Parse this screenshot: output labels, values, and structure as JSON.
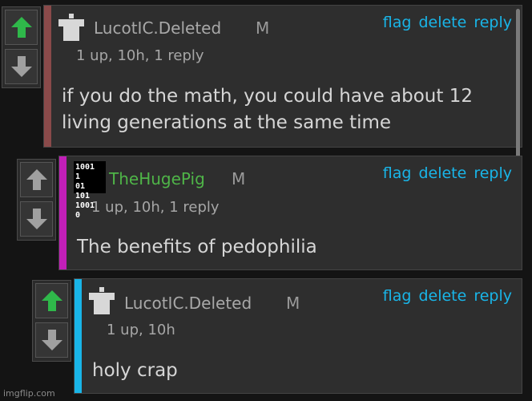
{
  "actions": {
    "flag": "flag",
    "delete": "delete",
    "reply": "reply"
  },
  "comments": [
    {
      "username": "LucotIC.Deleted",
      "badge": "M",
      "meta": "1 up, 10h, 1 reply",
      "body_lines": [
        "if you do the math, you could have about 12",
        "living generations at the same time"
      ],
      "accent": "#8a4a4a",
      "username_color": "#a8a8a8"
    },
    {
      "username": "TheHugePig",
      "badge": "M",
      "meta": "1 up, 10h, 1 reply",
      "body_lines": [
        "The benefits of pedophilia"
      ],
      "accent": "#c21fb8",
      "username_color": "#4fb548",
      "avatar_text": [
        "1001 1",
        "01 101",
        "1001 0"
      ]
    },
    {
      "username": "LucotIC.Deleted",
      "badge": "M",
      "meta": "1 up, 10h",
      "body_lines": [
        "holy crap"
      ],
      "accent": "#19b5e8",
      "username_color": "#a8a8a8"
    }
  ],
  "colors": {
    "upvoted": "#2fb84a",
    "neutral": "#a0a0a0",
    "link": "#19b5e8"
  },
  "watermark": "imgflip.com"
}
